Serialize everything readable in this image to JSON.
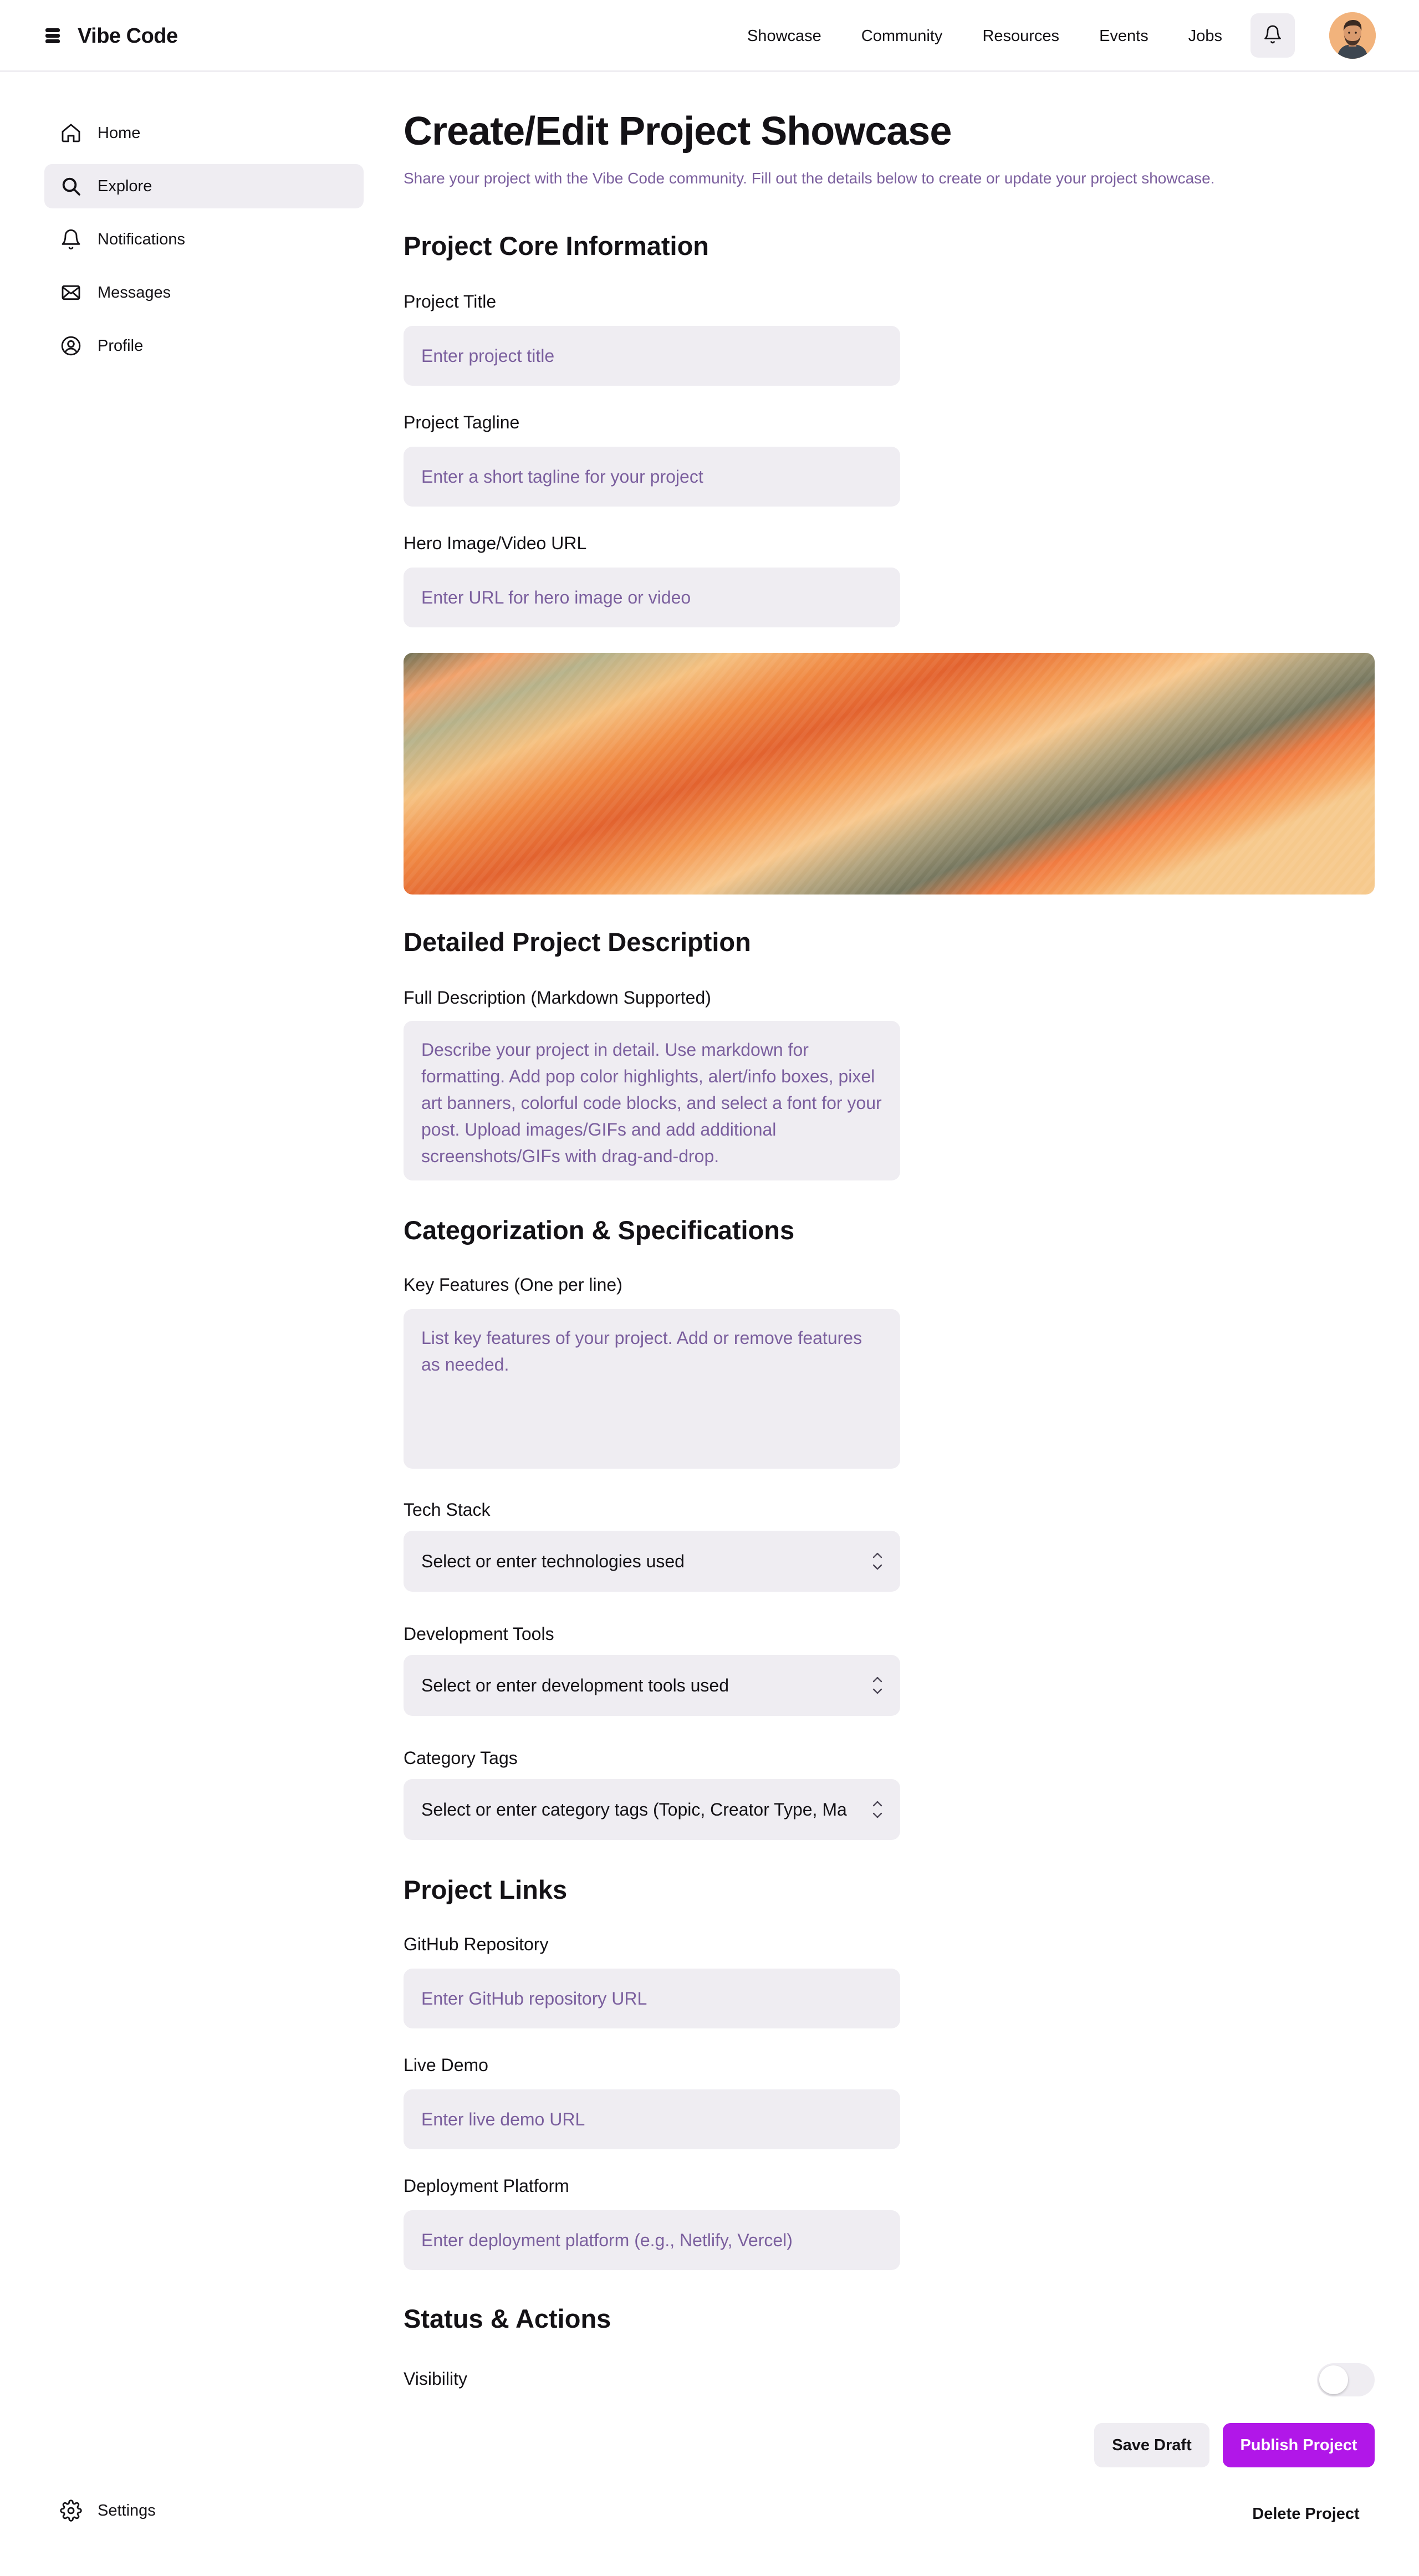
{
  "brand": {
    "name": "Vibe Code",
    "icon": "layers-icon"
  },
  "topnav": {
    "items": [
      "Showcase",
      "Community",
      "Resources",
      "Events",
      "Jobs"
    ]
  },
  "header": {
    "bell_icon": "bell-icon",
    "avatar": "user-avatar"
  },
  "sidebar": {
    "items": [
      {
        "label": "Home",
        "icon": "home-icon"
      },
      {
        "label": "Explore",
        "icon": "search-icon",
        "active": true
      },
      {
        "label": "Notifications",
        "icon": "bell-icon"
      },
      {
        "label": "Messages",
        "icon": "mail-icon"
      },
      {
        "label": "Profile",
        "icon": "user-circle-icon"
      }
    ],
    "settings": {
      "label": "Settings",
      "icon": "gear-icon"
    }
  },
  "page": {
    "title": "Create/Edit Project Showcase",
    "subtitle": "Share your project with the Vibe Code community. Fill out the details below to create or update your project showcase."
  },
  "sections": {
    "core": "Project Core Information",
    "description": "Detailed Project Description",
    "categorization": "Categorization & Specifications",
    "links": "Project Links",
    "status": "Status & Actions"
  },
  "fields": {
    "title": {
      "label": "Project Title",
      "placeholder": "Enter project title"
    },
    "tagline": {
      "label": "Project Tagline",
      "placeholder": "Enter a short tagline for your project"
    },
    "hero": {
      "label": "Hero Image/Video URL",
      "placeholder": "Enter URL for hero image or video"
    },
    "full_description": {
      "label": "Full Description (Markdown Supported)",
      "placeholder": "Describe your project in detail. Use markdown for formatting. Add pop color highlights, alert/info boxes, pixel art banners, colorful code blocks, and select a font for your post. Upload images/GIFs and add additional screenshots/GIFs with drag-and-drop."
    },
    "key_features": {
      "label": "Key Features (One per line)",
      "placeholder": "List key features of your project. Add or remove features as needed."
    },
    "tech_stack": {
      "label": "Tech Stack",
      "value": "Select or enter technologies used"
    },
    "dev_tools": {
      "label": "Development Tools",
      "value": "Select or enter development tools used"
    },
    "category_tags": {
      "label": "Category Tags",
      "value": "Select or enter category tags (Topic, Creator Type, Ma"
    },
    "github": {
      "label": "GitHub Repository",
      "placeholder": "Enter GitHub repository URL"
    },
    "live_demo": {
      "label": "Live Demo",
      "placeholder": "Enter live demo URL"
    },
    "deployment": {
      "label": "Deployment Platform",
      "placeholder": "Enter deployment platform (e.g., Netlify, Vercel)"
    },
    "visibility": {
      "label": "Visibility",
      "enabled": false
    }
  },
  "actions": {
    "save_draft": "Save Draft",
    "publish": "Publish Project",
    "delete": "Delete Project"
  },
  "colors": {
    "accent": "#b117e8",
    "muted_text": "#7b5f9e",
    "field_bg": "#efedf2"
  }
}
